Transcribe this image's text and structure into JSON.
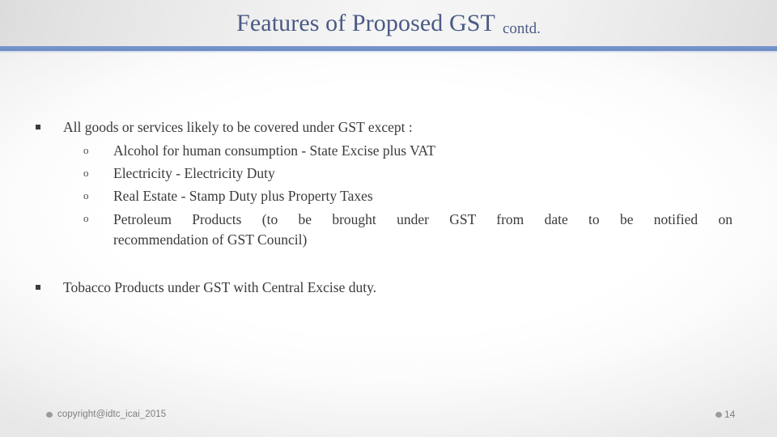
{
  "slide": {
    "title_main": "Features of Proposed GST",
    "title_suffix": "contd.",
    "accent_color": "#7190c8",
    "title_color": "#4a5a85",
    "body_text_color": "#3a3a3a",
    "footer_color": "#7d7d7d"
  },
  "body": {
    "bullets": [
      {
        "marker": "square-bullet",
        "text": "All goods or services likely to be covered under GST except :",
        "sub_items": [
          {
            "marker": "circle-bullet",
            "text": "Alcohol for human consumption - State Excise plus VAT"
          },
          {
            "marker": "circle-bullet",
            "text": "Electricity - Electricity Duty"
          },
          {
            "marker": "circle-bullet",
            "text": "Real Estate - Stamp Duty plus Property Taxes"
          },
          {
            "marker": "circle-bullet",
            "line1": "Petroleum Products (to be brought under GST from date to be notified on",
            "line2": "recommendation of GST Council)"
          }
        ]
      },
      {
        "marker": "square-bullet",
        "text": "Tobacco Products under GST with Central Excise duty."
      }
    ]
  },
  "footer": {
    "copyright": "copyright@idtc_icai_2015",
    "page_number": "14",
    "bullet_glyph": "●"
  },
  "markers": {
    "circle": "o"
  }
}
